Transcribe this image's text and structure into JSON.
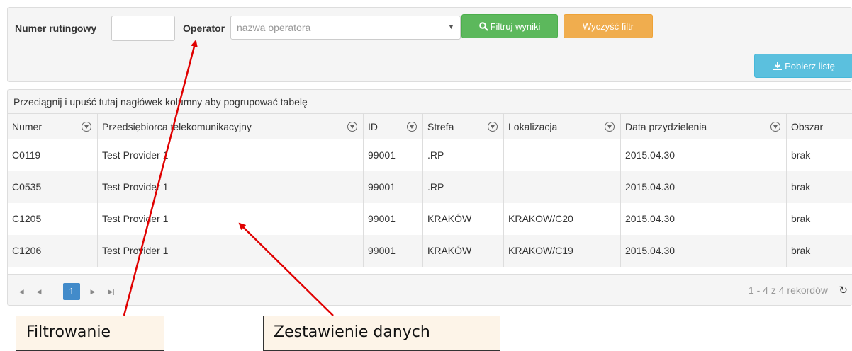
{
  "filters": {
    "routing_number_label": "Numer rutingowy",
    "routing_number_value": "",
    "operator_label": "Operator",
    "operator_placeholder": "nazwa operatora",
    "filter_button": "Filtruj wyniki",
    "clear_button": "Wyczyść filtr",
    "download_button": "Pobierz listę"
  },
  "grid": {
    "group_hint": "Przeciągnij i upuść tutaj nagłówek kolumny aby pogrupować tabelę",
    "columns": [
      "Numer",
      "Przedsiębiorca telekomunikacyjny",
      "ID",
      "Strefa",
      "Lokalizacja",
      "Data przydzielenia",
      "Obszar"
    ],
    "rows": [
      [
        "C0119",
        "Test Provider 1",
        "99001",
        ".RP",
        "",
        "2015.04.30",
        "brak"
      ],
      [
        "C0535",
        "Test Provider 1",
        "99001",
        ".RP",
        "",
        "2015.04.30",
        "brak"
      ],
      [
        "C1205",
        "Test Provider 1",
        "99001",
        "KRAKÓW",
        "KRAKOW/C20",
        "2015.04.30",
        "brak"
      ],
      [
        "C1206",
        "Test Provider 1",
        "99001",
        "KRAKÓW",
        "KRAKOW/C19",
        "2015.04.30",
        "brak"
      ]
    ],
    "pager": {
      "current_page": "1",
      "info": "1 - 4 z 4 rekordów"
    }
  },
  "annotations": {
    "filtering": "Filtrowanie",
    "data_summary": "Zestawienie danych"
  },
  "colors": {
    "filter_button": "#5cb85c",
    "clear_button": "#f0ad4e",
    "download_button": "#5bc0de",
    "active_page": "#428bca",
    "arrow": "#e00000"
  }
}
